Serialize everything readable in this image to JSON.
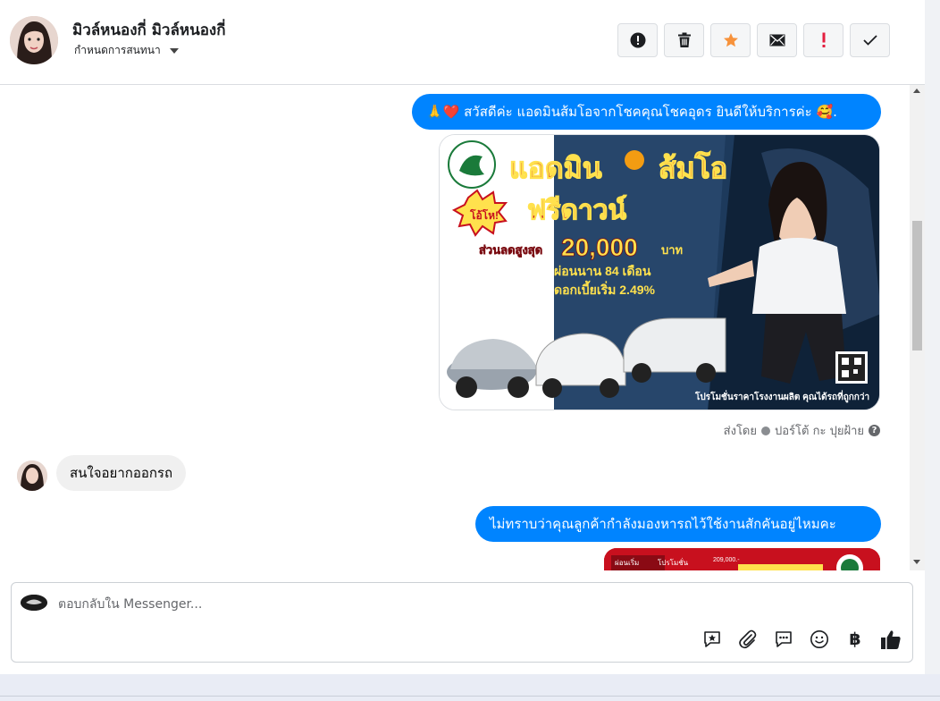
{
  "header": {
    "contact_name": "มิวล์หนองกี่ มิวล์หนองกี่",
    "assign_label": "กำหนดการสนทนา",
    "actions": [
      {
        "name": "spam-button",
        "icon": "alert-circle-icon"
      },
      {
        "name": "delete-button",
        "icon": "trash-icon"
      },
      {
        "name": "star-button",
        "icon": "star-icon"
      },
      {
        "name": "mark-unread-button",
        "icon": "envelope-icon"
      },
      {
        "name": "important-button",
        "icon": "exclamation-icon"
      },
      {
        "name": "mark-done-button",
        "icon": "check-icon"
      }
    ]
  },
  "thread": {
    "msg1": {
      "emoji": "🙏❤️",
      "text": " สวัสดีค่ะ แอดมินส้มโอจากโชคคุณโชคอุดร ยินดีให้บริการค่ะ ",
      "emoji_end": "🥰."
    },
    "promo": {
      "headline": "แอดมิน",
      "headline2": "ส้มโอ",
      "badge": "โอ้โห!",
      "free_down": "ฟรีดาวน์",
      "discount_label": "ส่วนลดสูงสุด",
      "discount_amount": "20,000",
      "discount_unit": "บาท",
      "installment": "ผ่อนนาน 84 เดือน",
      "interest": "ดอกเบี้ยเริ่ม 2.49%",
      "footer": "โปรโมชั่นราคาโรงงานผลิต คุณได้รถที่ถูกกว่า"
    },
    "sent_by_label": "ส่งโดย",
    "sent_by_name": "ปอร์โต้ กะ ปุยฝ้าย",
    "help_mark": "?",
    "msg2": "สนใจอยากออกรถ",
    "msg3": "ไม่ทราบว่าคุณลูกค้ากำลังมองหารถไว้ใช้งานสักคันอยู่ไหมคะ",
    "promo2": {
      "left": "ผ่อนเริ่ม",
      "mid": "โปรโมชั่น",
      "price": "209,000.-"
    }
  },
  "composer": {
    "placeholder": "ตอบกลับใน Messenger...",
    "tools": [
      "saved-reply-icon",
      "attachment-icon",
      "chat-bubble-icon",
      "emoji-icon",
      "baht-icon",
      "thumbs-up-icon"
    ],
    "baht_symbol": "฿"
  },
  "colors": {
    "accent": "#0084ff",
    "star": "#f7923b",
    "important": "#e41e3f",
    "promo_red": "#c8101e"
  }
}
